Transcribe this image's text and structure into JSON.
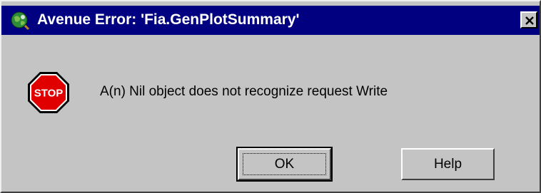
{
  "dialog": {
    "title": "Avenue Error: 'Fia.GenPlotSummary'",
    "title_icon": "arcview-globe-icon",
    "close_icon": "close-x-icon",
    "message_icon": "stop-sign-icon",
    "stop_label": "STOP",
    "message": "A(n) Nil object does not recognize request Write",
    "ok_label": "OK",
    "help_label": "Help",
    "colors": {
      "titlebar": "#000080",
      "face": "#c4c4c4",
      "stop_red": "#e00000"
    }
  }
}
